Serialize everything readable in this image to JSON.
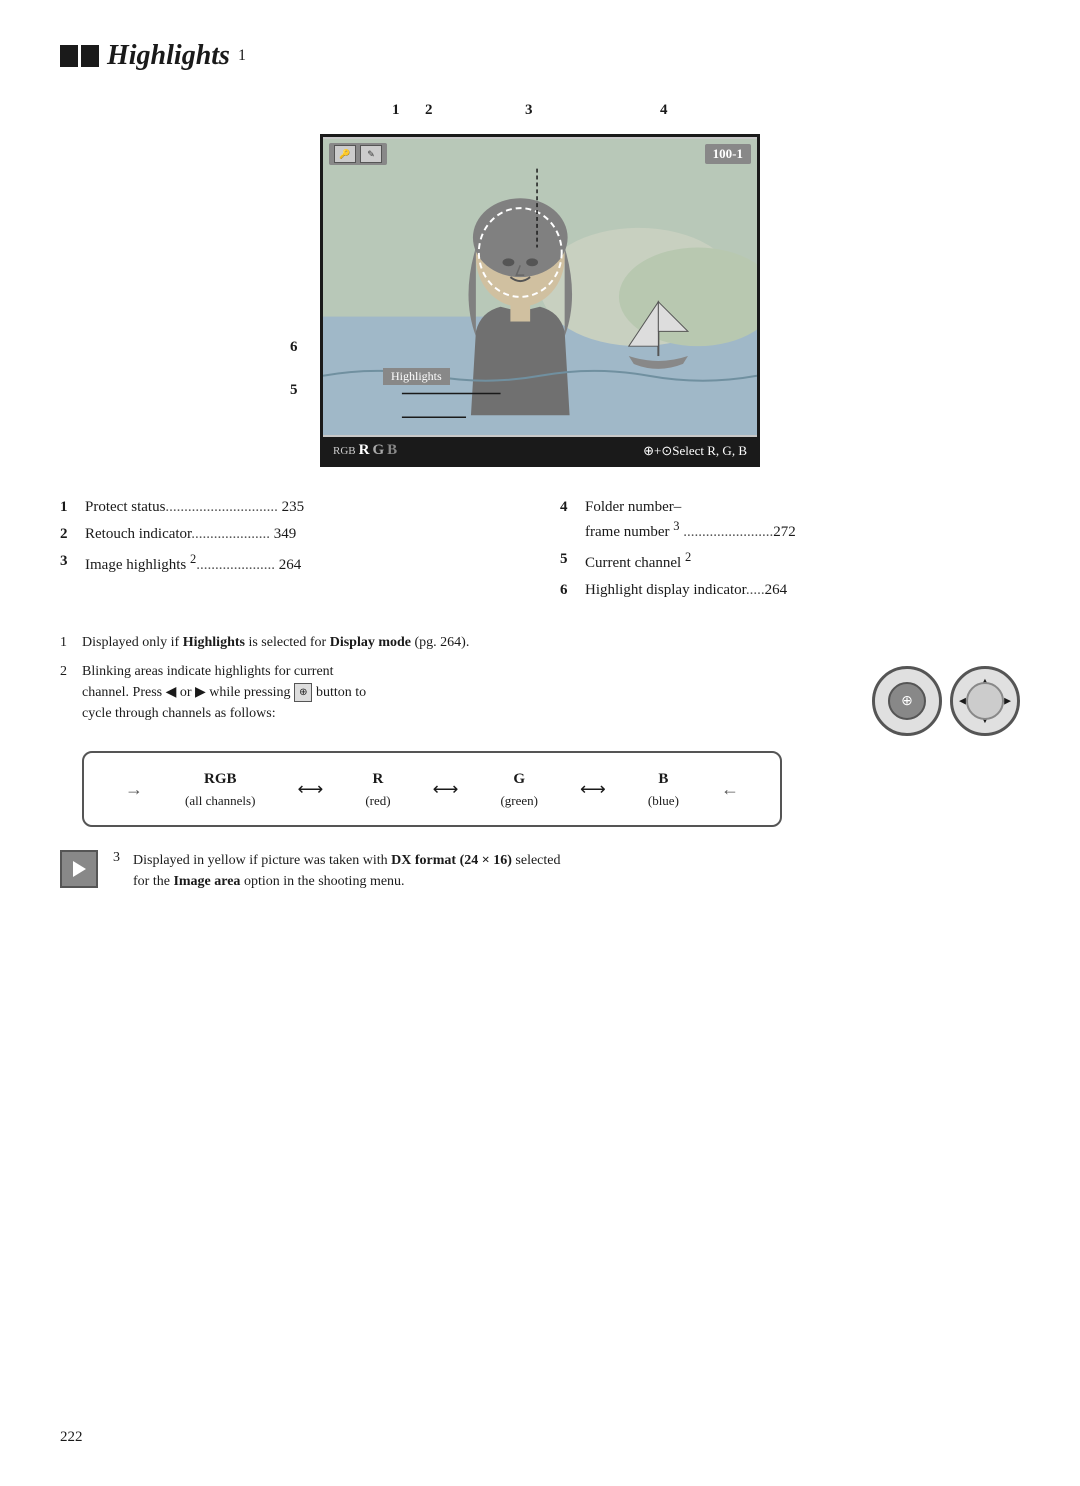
{
  "title": {
    "text": "Highlights",
    "superscript": "1"
  },
  "diagram": {
    "label1": "1",
    "label2": "2",
    "label3": "3",
    "label4": "4",
    "label5": "5",
    "label6": "6",
    "highlights_tag": "Highlights",
    "frame_number": "100-1",
    "rgb_prefix": "RGB",
    "rgb_r": "R",
    "rgb_g": "G",
    "rgb_b": "B",
    "select_text": "⊕+⊙Select R, G, B"
  },
  "info_items": [
    {
      "num": "1",
      "label": "Protect status",
      "dots": "......................",
      "page": "235"
    },
    {
      "num": "2",
      "label": "Retouch indicator",
      "dots": "...................",
      "page": "349"
    },
    {
      "num": "3",
      "label": "Image highlights ",
      "sup": "2",
      "dots": "...................",
      "page": "264"
    }
  ],
  "info_items_right": [
    {
      "num": "4",
      "label": "Folder number–\nframe number ",
      "sup": "3",
      "dots": "........................",
      "page": "272"
    },
    {
      "num": "5",
      "label": "Current channel ",
      "sup": "2",
      "dots": "",
      "page": ""
    },
    {
      "num": "6",
      "label": "Highlight display indicator",
      "dots": "....",
      "page": "264"
    }
  ],
  "footnote1": {
    "num": "1",
    "text": "Displayed only if ",
    "bold1": "Highlights",
    "text2": " is selected for ",
    "bold2": "Display mode",
    "text3": " (pg. 264)."
  },
  "footnote2": {
    "num": "2",
    "line1": "Blinking areas indicate highlights for current",
    "line2": "channel.  Press ◀ or ▶ while pressing ",
    "line2b": " button to",
    "line3": "cycle through channels as follows:"
  },
  "channels": [
    {
      "name": "RGB",
      "sub": "(all channels)"
    },
    {
      "name": "R",
      "sub": "(red)"
    },
    {
      "name": "G",
      "sub": "(green)"
    },
    {
      "name": "B",
      "sub": "(blue)"
    }
  ],
  "footnote3": {
    "num": "3",
    "text1": "Displayed in yellow if picture was taken with ",
    "bold1": "DX format (24 × 16)",
    "text2": " selected\nfor the ",
    "bold2": "Image area",
    "text3": " option in the shooting menu."
  },
  "page_number": "222"
}
